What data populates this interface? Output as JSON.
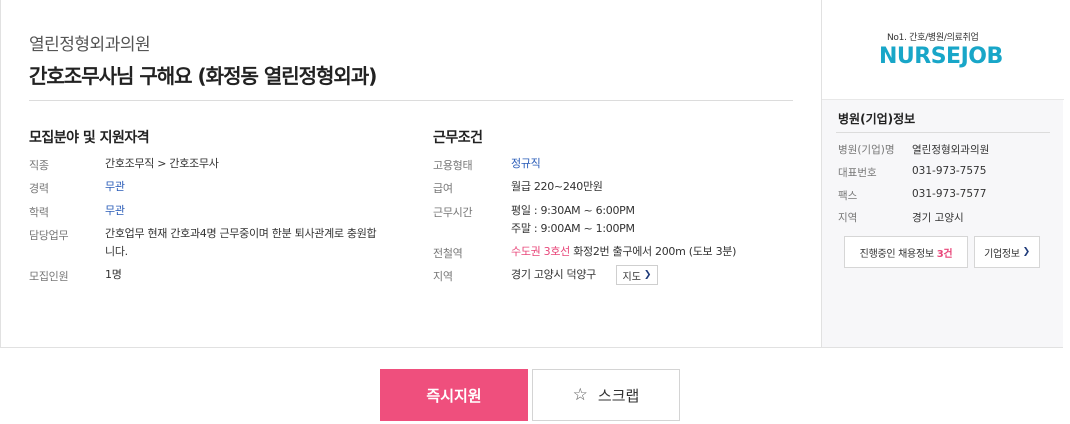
{
  "header": {
    "company": "열린정형외과의원",
    "title": "간호조무사님 구해요 (화정동 열린정형외과)"
  },
  "recruit": {
    "section_title": "모집분야 및 지원자격",
    "rows": [
      {
        "label": "직종",
        "value": "간호조무직 > 간호조무사"
      },
      {
        "label": "경력",
        "value": "무관"
      },
      {
        "label": "학력",
        "value": "무관"
      },
      {
        "label": "담당업무",
        "value": "간호업무 현재 간호과4명 근무중이며 한분 퇴사관계로 충원합",
        "value2": "니다."
      },
      {
        "label": "모집인원",
        "value": "1명"
      }
    ]
  },
  "conditions": {
    "section_title": "근무조건",
    "rows": [
      {
        "label": "고용형태",
        "value": "정규직"
      },
      {
        "label": "급여",
        "value": "월급 220~240만원"
      },
      {
        "label": "근무시간",
        "value": "평일 : 9:30AM ~ 6:00PM",
        "value2": "주말 : 9:00AM ~ 1:00PM"
      },
      {
        "label": "전철역",
        "value_pink": "수도권 3호선",
        "value": "화정2번 출구에서 200m (도보 3분)"
      },
      {
        "label": "지역",
        "value": "경기 고양시 덕양구"
      }
    ],
    "map_button": "지도"
  },
  "sidebar": {
    "logo_tagline": "No1. 간호/병원/의료취업",
    "logo_text": "NURSEJOB",
    "section_title": "병원(기업)정보",
    "rows": [
      {
        "label": "병원(기업)명",
        "value": "열린정형외과의원"
      },
      {
        "label": "대표번호",
        "value": "031-973-7575"
      },
      {
        "label": "팩스",
        "value": "031-973-7577"
      },
      {
        "label": "지역",
        "value": "경기 고양시"
      }
    ],
    "jobs_button": "진행중인 채용정보",
    "jobs_count": "3건",
    "company_button": "기업정보"
  },
  "actions": {
    "apply": "즉시지원",
    "scrap": "스크랩"
  },
  "colors": {
    "accent_pink": "#ef4f7d",
    "link_blue": "#2a5cb8",
    "logo_blue": "#18a6c8"
  },
  "icons": [
    "chevron-right-icon",
    "star-icon"
  ]
}
